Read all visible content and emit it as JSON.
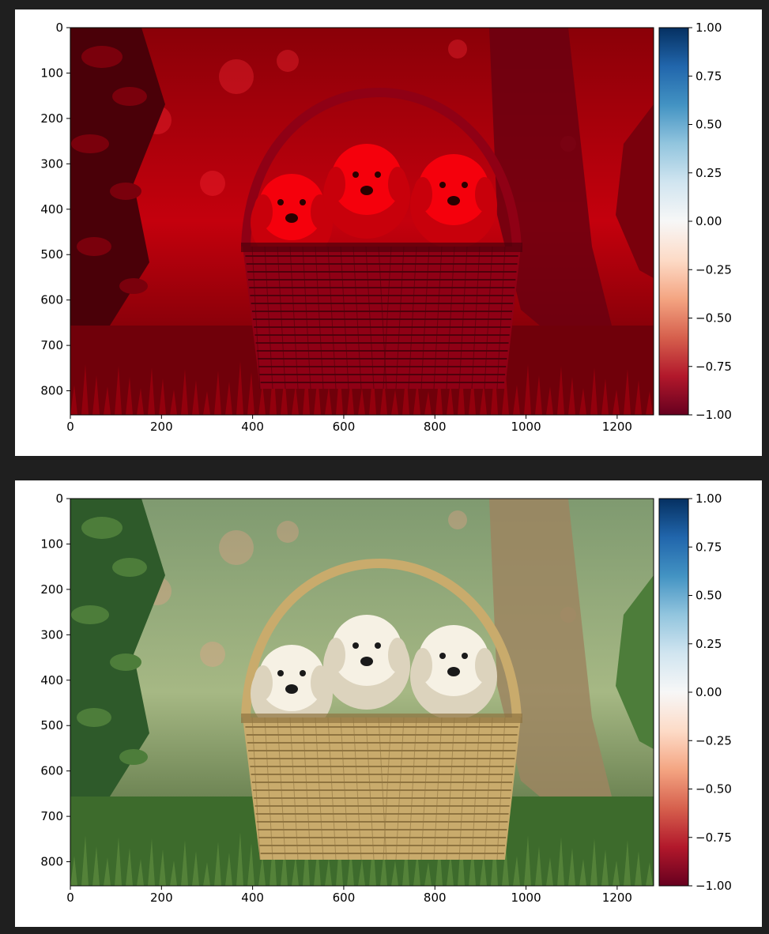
{
  "colors": {
    "page_background": "#1f1f1f",
    "panel_background": "#ffffff",
    "colormap": [
      "#67001f",
      "#b2182b",
      "#d6604d",
      "#f4a582",
      "#fddbc7",
      "#f7f7f7",
      "#d1e5f0",
      "#92c5de",
      "#4393c3",
      "#2166ac",
      "#053061"
    ]
  },
  "chart_data": [
    {
      "type": "heatmap",
      "name": "red-channel-image",
      "title": "",
      "xlabel": "",
      "ylabel": "",
      "image_description": "three white puppies in a wicker basket in a garden, rendered in red tones only",
      "image_tint": "red",
      "xlim": [
        0,
        1280
      ],
      "ylim": [
        853,
        0
      ],
      "x_ticks": [
        0,
        200,
        400,
        600,
        800,
        1000,
        1200
      ],
      "y_ticks": [
        0,
        100,
        200,
        300,
        400,
        500,
        600,
        700,
        800
      ],
      "colorbar": {
        "colormap": "RdBu",
        "range": [
          -1.0,
          1.0
        ],
        "ticks": [
          1.0,
          0.75,
          0.5,
          0.25,
          0.0,
          -0.25,
          -0.5,
          -0.75,
          -1.0
        ],
        "tick_labels": [
          "1.00",
          "0.75",
          "0.50",
          "0.25",
          "0.00",
          "−0.25",
          "−0.50",
          "−0.75",
          "−1.00"
        ]
      }
    },
    {
      "type": "heatmap",
      "name": "original-image",
      "title": "",
      "xlabel": "",
      "ylabel": "",
      "image_description": "three white puppies in a wicker basket in a garden, natural colors",
      "image_tint": "natural",
      "xlim": [
        0,
        1280
      ],
      "ylim": [
        853,
        0
      ],
      "x_ticks": [
        0,
        200,
        400,
        600,
        800,
        1000,
        1200
      ],
      "y_ticks": [
        0,
        100,
        200,
        300,
        400,
        500,
        600,
        700,
        800
      ],
      "colorbar": {
        "colormap": "RdBu",
        "range": [
          -1.0,
          1.0
        ],
        "ticks": [
          1.0,
          0.75,
          0.5,
          0.25,
          0.0,
          -0.25,
          -0.5,
          -0.75,
          -1.0
        ],
        "tick_labels": [
          "1.00",
          "0.75",
          "0.50",
          "0.25",
          "0.00",
          "−0.25",
          "−0.50",
          "−0.75",
          "−1.00"
        ]
      }
    }
  ]
}
